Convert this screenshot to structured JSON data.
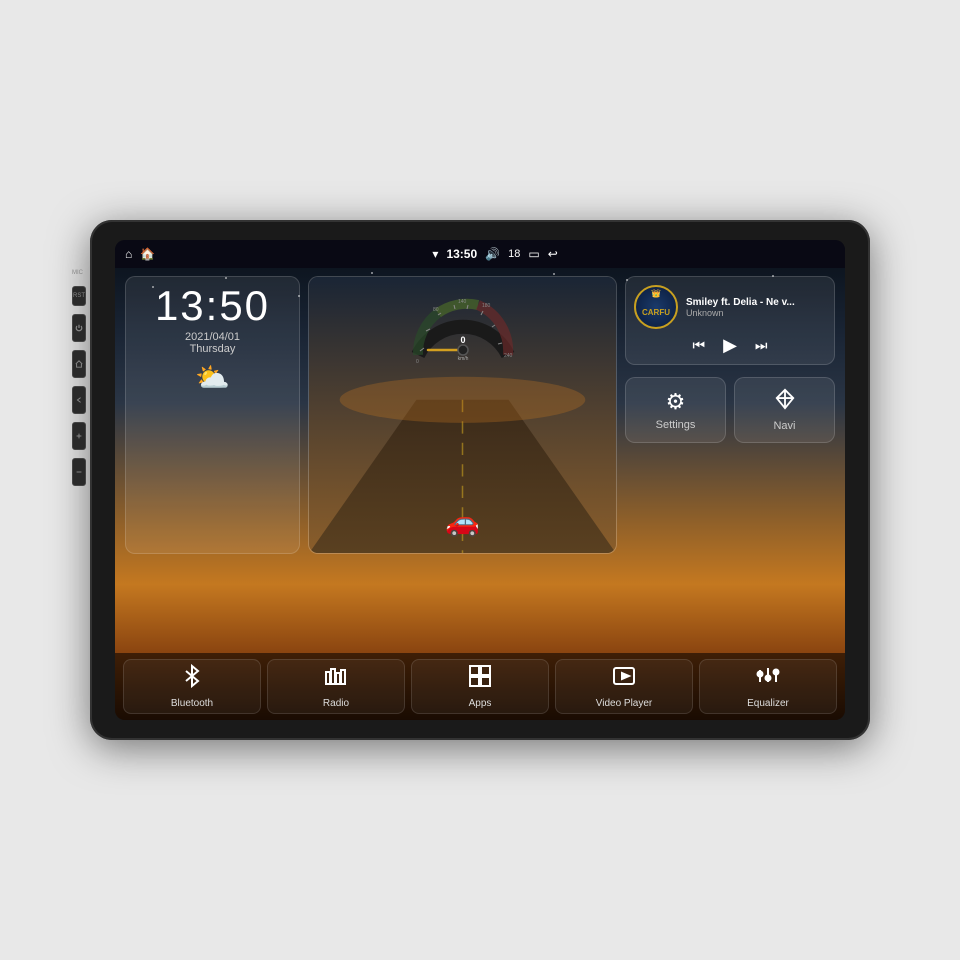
{
  "device": {
    "outer_bg": "#1a1a1a"
  },
  "status_bar": {
    "left_icons": [
      "home-icon",
      "house-icon"
    ],
    "time": "13:50",
    "volume_icon": "volume-icon",
    "volume_level": "18",
    "battery_icon": "battery-icon",
    "back_icon": "back-icon",
    "wifi_icon": "wifi-icon"
  },
  "clock": {
    "time": "13:50",
    "date": "2021/04/01",
    "day": "Thursday"
  },
  "music": {
    "title": "Smiley ft. Delia - Ne v...",
    "artist": "Unknown",
    "logo_text": "CARFU"
  },
  "speedometer": {
    "speed": "0",
    "unit": "km/h"
  },
  "settings_btn": {
    "label": "Settings"
  },
  "navi_btn": {
    "label": "Navi"
  },
  "bottom_nav": [
    {
      "id": "bluetooth",
      "label": "Bluetooth",
      "icon": "bluetooth"
    },
    {
      "id": "radio",
      "label": "Radio",
      "icon": "radio"
    },
    {
      "id": "apps",
      "label": "Apps",
      "icon": "apps"
    },
    {
      "id": "video-player",
      "label": "Video Player",
      "icon": "video"
    },
    {
      "id": "equalizer",
      "label": "Equalizer",
      "icon": "equalizer"
    }
  ],
  "side_buttons": [
    {
      "id": "mic",
      "label": "MIC"
    },
    {
      "id": "rst",
      "label": "RST"
    },
    {
      "id": "power",
      "label": ""
    },
    {
      "id": "home",
      "label": ""
    },
    {
      "id": "back",
      "label": ""
    },
    {
      "id": "vol-up",
      "label": ""
    },
    {
      "id": "vol-down",
      "label": ""
    }
  ]
}
